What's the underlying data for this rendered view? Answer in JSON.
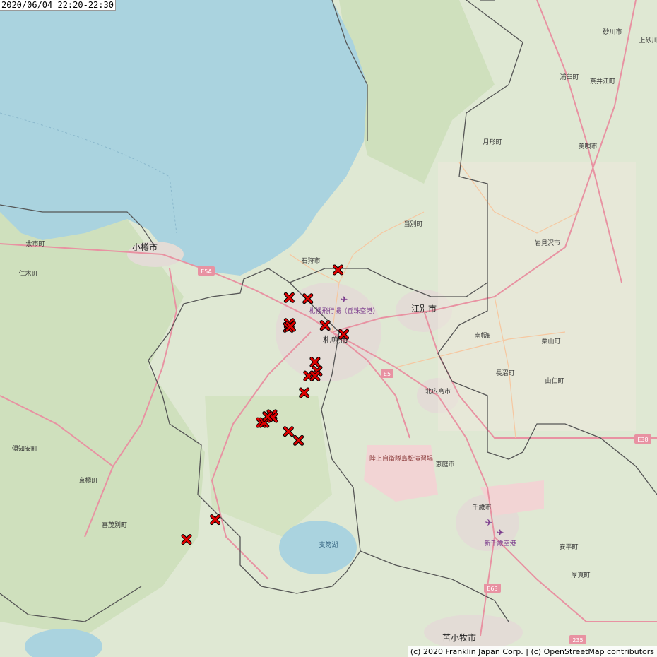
{
  "time_range": "2020/06/04 22:20-22:30",
  "attribution": "(c) 2020 Franklin Japan Corp. | (c) OpenStreetMap contributors",
  "colors": {
    "sea": "#aad3df",
    "land": "#dfe8d3",
    "forest": "#cfe0bd",
    "urban": "#e3dcd6",
    "road": "#e892a2",
    "marker": "#e00000"
  },
  "marker_icon": "x-mark",
  "places": {
    "sapporo": "札幌市",
    "otaru": "小樽市",
    "ishikari": "石狩市",
    "ebetsu": "江別市",
    "tobetsu": "当別町",
    "kitahiroshima": "北広島市",
    "eniwa": "恵庭市",
    "chitose": "千歳市",
    "tomakomai": "苫小牧市",
    "iwamizawa": "岩見沢市",
    "yoichi": "余市町",
    "niki": "仁木町",
    "kutchan": "倶知安町",
    "kyogoku": "京極町",
    "kimobetsu": "喜茂別町",
    "nanporo": "南幌町",
    "naganuma": "長沼町",
    "kuriyama": "栗山町",
    "yuni": "由仁町",
    "abira": "安平町",
    "atsuma": "厚真町",
    "tsukigata": "月形町",
    "bibai": "美唄市",
    "urausu": "浦臼町",
    "naie": "奈井江町",
    "sunagawa": "砂川市",
    "kamisunagawa": "上砂川",
    "shikotsu": "支笏湖",
    "okadama": "札幌飛行場（丘珠空港）",
    "new_chitose": "新千歳空港",
    "jsdf": "陸上自衛隊島松演習場"
  },
  "road_labels": {
    "e5a": "E5A",
    "e5": "E5",
    "e38": "E38",
    "e63": "E63",
    "r235": "235"
  },
  "strikes": [
    {
      "lat": 43.142,
      "lon": 141.407
    },
    {
      "lat": 43.114,
      "lon": 141.339
    },
    {
      "lat": 43.113,
      "lon": 141.365
    },
    {
      "lat": 43.088,
      "lon": 141.339
    },
    {
      "lat": 43.084,
      "lon": 141.338
    },
    {
      "lat": 43.085,
      "lon": 141.341
    },
    {
      "lat": 43.086,
      "lon": 141.389
    },
    {
      "lat": 43.077,
      "lon": 141.415
    },
    {
      "lat": 43.049,
      "lon": 141.375
    },
    {
      "lat": 43.04,
      "lon": 141.378
    },
    {
      "lat": 43.035,
      "lon": 141.366
    },
    {
      "lat": 43.035,
      "lon": 141.375
    },
    {
      "lat": 43.018,
      "lon": 141.36
    },
    {
      "lat": 42.996,
      "lon": 141.315
    },
    {
      "lat": 42.993,
      "lon": 141.316
    },
    {
      "lat": 42.988,
      "lon": 141.3
    },
    {
      "lat": 42.988,
      "lon": 141.304
    },
    {
      "lat": 42.994,
      "lon": 141.309
    },
    {
      "lat": 42.979,
      "lon": 141.338
    },
    {
      "lat": 42.97,
      "lon": 141.352
    },
    {
      "lat": 42.89,
      "lon": 141.236
    },
    {
      "lat": 42.87,
      "lon": 141.196
    }
  ]
}
